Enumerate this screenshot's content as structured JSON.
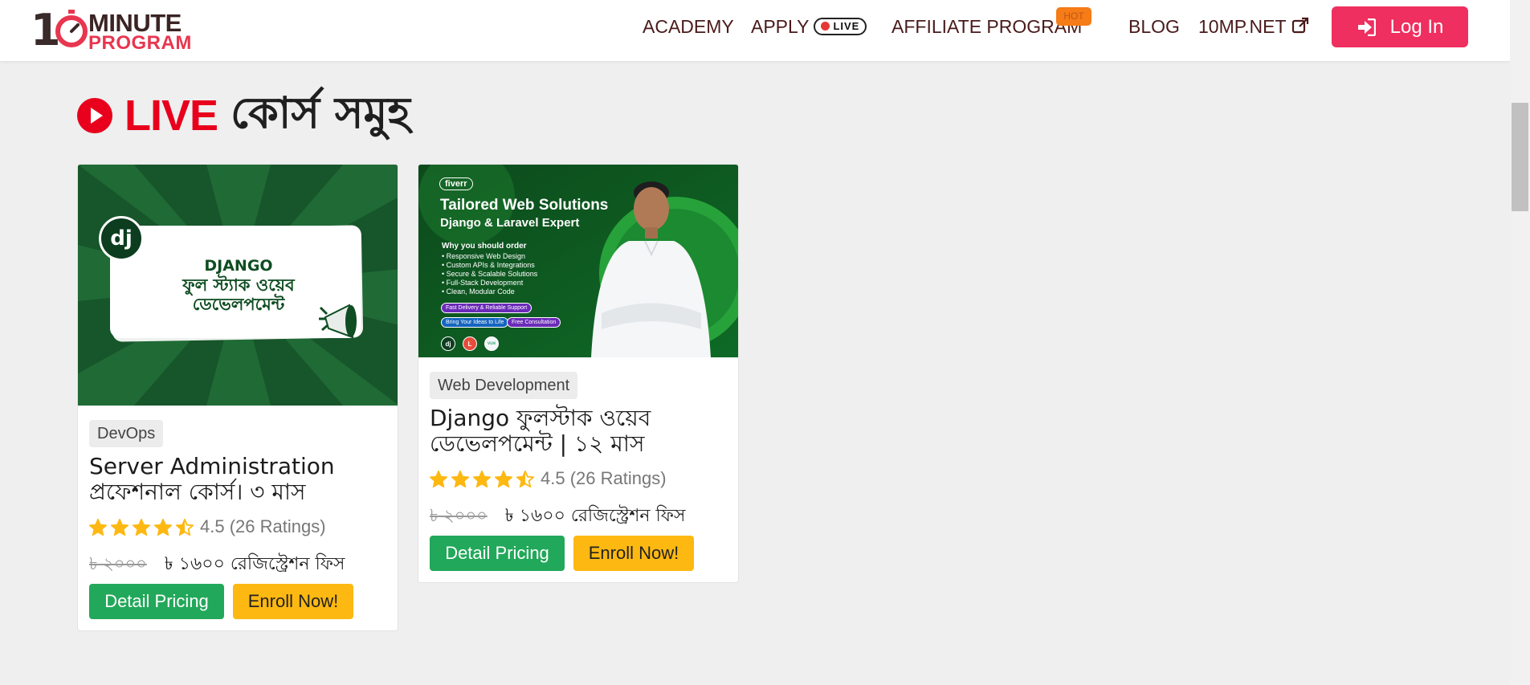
{
  "header": {
    "logo": {
      "prefix": "1",
      "line1": "MINUTE",
      "line2": "PROGRAM"
    },
    "nav": {
      "academy": "ACADEMY",
      "apply": "APPLY",
      "apply_badge": "LIVE",
      "affiliate": "AFFILIATE PROGRAM",
      "affiliate_badge": "HOT",
      "blog": "BLOG",
      "site": "10MP.NET"
    },
    "login_label": "Log In"
  },
  "section": {
    "title_highlight": "LIVE",
    "title_rest": "কোর্স সমুহ"
  },
  "courses": [
    {
      "thumbnail_text": [
        "DJANGO",
        "ফুল স্ট্যাক ওয়েব",
        "ডেভেলপমেন্ট"
      ],
      "thumbnail_logo": "dj",
      "category": "DevOps",
      "title_line1": "Server Administration",
      "title_line2": "প্রফেশনাল কোর্স। ৩ মাস",
      "rating": 4.5,
      "rating_text": "4.5 (26 Ratings)",
      "price_old": "৳ ২০০০",
      "price_new": "৳ ১৬০০ রেজিস্ট্রেশন ফিস",
      "detail_label": "Detail Pricing",
      "enroll_label": "Enroll Now!"
    },
    {
      "thumbnail_brand": "fiverr",
      "thumbnail_title": "Tailored Web Solutions",
      "thumbnail_subtitle": "Django & Laravel Expert",
      "thumbnail_heading": "Why you should order",
      "thumbnail_points": [
        "Responsive Web Design",
        "Custom APIs & Integrations",
        "Secure & Scalable Solutions",
        "Full-Stack Development",
        "Clean, Modular Code"
      ],
      "thumbnail_tags": [
        "Fast Delivery & Reliable Support",
        "Bring Your Ideas to Life",
        "Free Consultation"
      ],
      "thumbnail_tech": [
        "dj",
        "L",
        "vue"
      ],
      "category": "Web Development",
      "title_line1": "Django ফুলস্টাক ওয়েব",
      "title_line2": "ডেভেলপমেন্ট | ১২ মাস",
      "rating": 4.5,
      "rating_text": "4.5 (26 Ratings)",
      "price_old": "৳ ২০০০",
      "price_new": "৳ ১৬০০ রেজিস্ট্রেশন ফিস",
      "detail_label": "Detail Pricing",
      "enroll_label": "Enroll Now!"
    }
  ],
  "colors": {
    "brand_red": "#e8364f",
    "login_bg": "#ee2f5f",
    "live_red": "#e8001c",
    "green_btn": "#22a85a",
    "yellow_btn": "#fdb812",
    "star": "#fdb812"
  }
}
